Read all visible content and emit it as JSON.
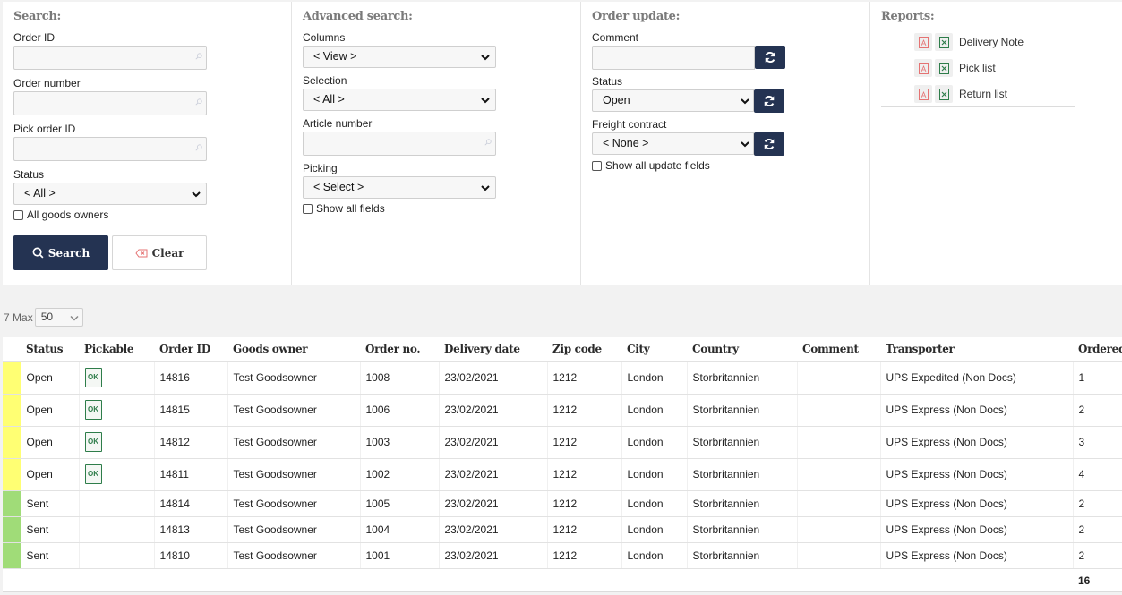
{
  "search": {
    "title": "Search:",
    "order_id_label": "Order ID",
    "order_id_value": "",
    "order_number_label": "Order number",
    "order_number_value": "",
    "pick_order_id_label": "Pick order ID",
    "pick_order_id_value": "",
    "status_label": "Status",
    "status_value": "< All >",
    "all_goods_owners_label": "All goods owners",
    "all_goods_owners_checked": false,
    "search_button": "Search",
    "clear_button": "Clear"
  },
  "advanced": {
    "title": "Advanced search:",
    "columns_label": "Columns",
    "columns_value": "< View >",
    "selection_label": "Selection",
    "selection_value": "< All >",
    "article_number_label": "Article number",
    "article_number_value": "",
    "picking_label": "Picking",
    "picking_value": "< Select >",
    "show_all_fields_label": "Show all fields",
    "show_all_fields_checked": false
  },
  "update": {
    "title": "Order update:",
    "comment_label": "Comment",
    "comment_value": "",
    "status_label": "Status",
    "status_value": "Open",
    "freight_label": "Freight contract",
    "freight_value": "< None >",
    "show_all_update_label": "Show all update fields",
    "show_all_update_checked": false
  },
  "reports": {
    "title": "Reports:",
    "items": [
      {
        "label": "Delivery Note"
      },
      {
        "label": "Pick list"
      },
      {
        "label": "Return list"
      }
    ]
  },
  "paging": {
    "count": "7",
    "max_label": "Max",
    "max_value": "50"
  },
  "colors": {
    "navy": "#243352",
    "open_stripe": "#ffff73",
    "sent_stripe": "#a0dc78",
    "ok_green": "#2e7d4a",
    "pdf_red": "#e57373",
    "xls_green": "#2e7d4a"
  },
  "table": {
    "headers": [
      "Status",
      "Pickable",
      "Order ID",
      "Goods owner",
      "Order no.",
      "Delivery date",
      "Zip code",
      "City",
      "Country",
      "Comment",
      "Transporter",
      "Ordered"
    ],
    "rows": [
      {
        "status": "Open",
        "pickable": "OK",
        "order_id": "14816",
        "goods_owner": "Test Goodsowner",
        "order_no": "1008",
        "delivery_date": "23/02/2021",
        "zip": "1212",
        "city": "London",
        "country": "Storbritannien",
        "comment": "",
        "transporter": "UPS Expedited (Non Docs)",
        "ordered": "1"
      },
      {
        "status": "Open",
        "pickable": "OK",
        "order_id": "14815",
        "goods_owner": "Test Goodsowner",
        "order_no": "1006",
        "delivery_date": "23/02/2021",
        "zip": "1212",
        "city": "London",
        "country": "Storbritannien",
        "comment": "",
        "transporter": "UPS Express (Non Docs)",
        "ordered": "2"
      },
      {
        "status": "Open",
        "pickable": "OK",
        "order_id": "14812",
        "goods_owner": "Test Goodsowner",
        "order_no": "1003",
        "delivery_date": "23/02/2021",
        "zip": "1212",
        "city": "London",
        "country": "Storbritannien",
        "comment": "",
        "transporter": "UPS Express (Non Docs)",
        "ordered": "3"
      },
      {
        "status": "Open",
        "pickable": "OK",
        "order_id": "14811",
        "goods_owner": "Test Goodsowner",
        "order_no": "1002",
        "delivery_date": "23/02/2021",
        "zip": "1212",
        "city": "London",
        "country": "Storbritannien",
        "comment": "",
        "transporter": "UPS Express (Non Docs)",
        "ordered": "4"
      },
      {
        "status": "Sent",
        "pickable": "",
        "order_id": "14814",
        "goods_owner": "Test Goodsowner",
        "order_no": "1005",
        "delivery_date": "23/02/2021",
        "zip": "1212",
        "city": "London",
        "country": "Storbritannien",
        "comment": "",
        "transporter": "UPS Express (Non Docs)",
        "ordered": "2"
      },
      {
        "status": "Sent",
        "pickable": "",
        "order_id": "14813",
        "goods_owner": "Test Goodsowner",
        "order_no": "1004",
        "delivery_date": "23/02/2021",
        "zip": "1212",
        "city": "London",
        "country": "Storbritannien",
        "comment": "",
        "transporter": "UPS Express (Non Docs)",
        "ordered": "2"
      },
      {
        "status": "Sent",
        "pickable": "",
        "order_id": "14810",
        "goods_owner": "Test Goodsowner",
        "order_no": "1001",
        "delivery_date": "23/02/2021",
        "zip": "1212",
        "city": "London",
        "country": "Storbritannien",
        "comment": "",
        "transporter": "UPS Express (Non Docs)",
        "ordered": "2"
      }
    ],
    "total_ordered": "16"
  }
}
